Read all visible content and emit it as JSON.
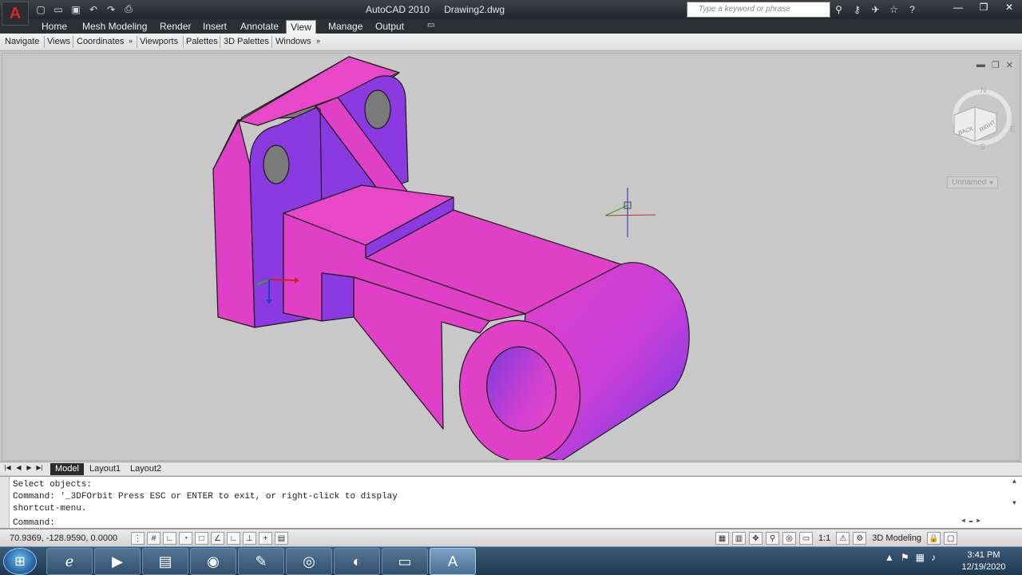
{
  "app": {
    "logo_letter": "A",
    "title": "AutoCAD 2010",
    "document": "Drawing2.dwg"
  },
  "qat_icons": [
    "new-icon",
    "open-icon",
    "save-icon",
    "undo-icon",
    "redo-icon",
    "plot-icon"
  ],
  "search": {
    "placeholder": "Type a keyword or phrase"
  },
  "ribbon": {
    "tabs": [
      "Home",
      "Mesh Modeling",
      "Render",
      "Insert",
      "Annotate",
      "View",
      "Manage",
      "Output"
    ],
    "active_tab": "View",
    "panels": [
      "Navigate",
      "Views",
      "Coordinates",
      "Viewports",
      "Palettes",
      "3D Palettes",
      "Windows"
    ]
  },
  "viewcube": {
    "north": "N",
    "east": "E",
    "south": "S",
    "face_left": "BACK",
    "face_right": "RIGHT"
  },
  "ucs_name": "Unnamed",
  "layout_tabs": [
    "Model",
    "Layout1",
    "Layout2"
  ],
  "active_layout": "Model",
  "command": {
    "history": [
      "Select objects:",
      "Command: '_3DFOrbit Press ESC or ENTER to exit, or right-click to display",
      "shortcut-menu."
    ],
    "prompt": "Command:"
  },
  "status": {
    "coordinates": "70.9369, -128.9590, 0.0000",
    "annotation_scale": "1:1",
    "workspace": "3D Modeling"
  },
  "taskbar": {
    "time": "3:41 PM",
    "date": "12/19/2020"
  },
  "model_colors": {
    "main": "#e040c8",
    "side": "#8a3ae0",
    "grey": "#7a7a7a"
  }
}
